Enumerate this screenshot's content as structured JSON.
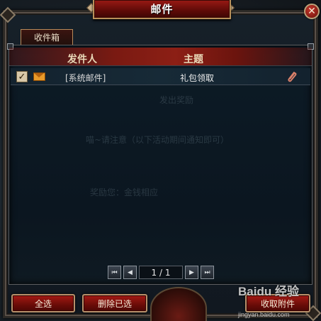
{
  "window": {
    "title": "邮件",
    "close_glyph": "✕"
  },
  "tabs": [
    {
      "label": "收件箱",
      "active": true
    }
  ],
  "table": {
    "columns": [
      "发件人",
      "主题"
    ],
    "rows": [
      {
        "checked": true,
        "sender": "[系统邮件]",
        "subject": "礼包领取",
        "has_attachment": true,
        "icon": "envelope-icon"
      }
    ]
  },
  "ghost_text": {
    "line1": "发出奖励",
    "line2": "喵~请注意（以下活动期间通知即可）",
    "line3": "奖励您：金钱相应"
  },
  "pagination": {
    "display": "1 / 1",
    "first_glyph": "⏮",
    "prev_glyph": "◀",
    "next_glyph": "▶",
    "last_glyph": "⏭"
  },
  "buttons": {
    "select_all": "全选",
    "delete_selected": "删除已选",
    "receive_attachment": "收取附件"
  },
  "watermark": {
    "text": "Baidu 经验",
    "sub": "jingyan.baidu.com"
  },
  "colors": {
    "accent_red": "#8c1f15",
    "header_gold": "#e9d9b8",
    "envelope_orange": "#e89a2a"
  }
}
